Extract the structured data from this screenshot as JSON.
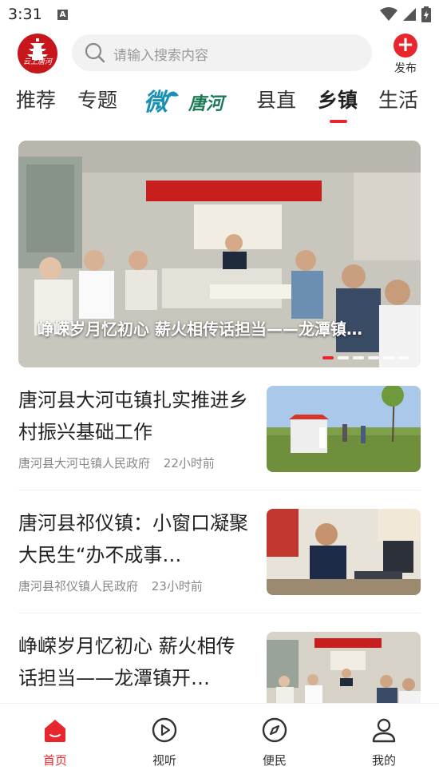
{
  "status": {
    "time": "3:31",
    "notif_icon": "A"
  },
  "header": {
    "logo_text": "云上唐河",
    "search_placeholder": "请输入搜索内容",
    "publish_label": "发布"
  },
  "tabs": [
    {
      "label": "推荐"
    },
    {
      "label": "专题"
    },
    {
      "label": "县直"
    },
    {
      "label": "乡镇"
    },
    {
      "label": "生活"
    }
  ],
  "brand_tab": {
    "icon": "weibo-tanghe-logo",
    "text": "唐河"
  },
  "banner": {
    "caption": "峥嵘岁月忆初心 薪火相传话担当——龙潭镇…",
    "slide_count": 6,
    "active_slide": 1
  },
  "news": [
    {
      "title": "唐河县大河屯镇扎实推进乡村振兴基础工作",
      "source": "唐河县大河屯镇人民政府",
      "time": "22小时前"
    },
    {
      "title": "唐河县祁仪镇：小窗口凝聚大民生“办不成事…",
      "source": "唐河县祁仪镇人民政府",
      "time": "23小时前"
    },
    {
      "title": "峥嵘岁月忆初心 薪火相传话担当——龙潭镇开…",
      "source": "",
      "time": ""
    }
  ],
  "nav": [
    {
      "label": "首页",
      "icon": "home-icon"
    },
    {
      "label": "视听",
      "icon": "play-icon"
    },
    {
      "label": "便民",
      "icon": "compass-icon"
    },
    {
      "label": "我的",
      "icon": "user-icon"
    }
  ],
  "colors": {
    "accent": "#e8262d",
    "logo_red": "#c8161d"
  }
}
